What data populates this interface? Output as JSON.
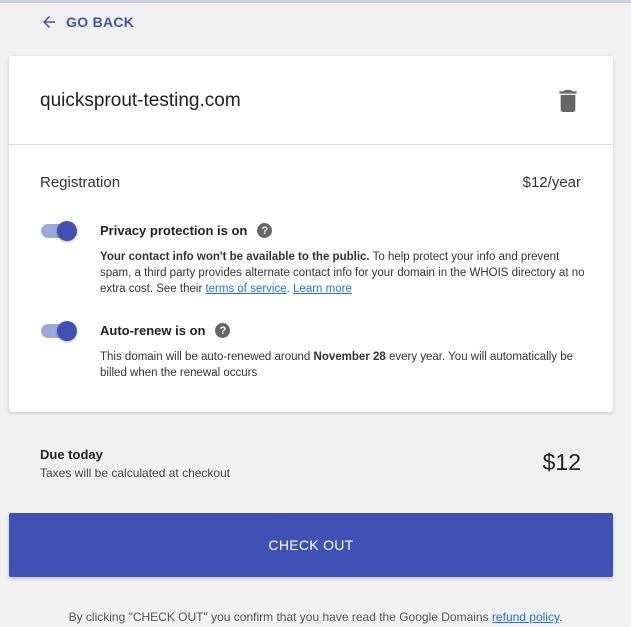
{
  "nav": {
    "back_label": "GO BACK"
  },
  "domain_card": {
    "domain_name": "quicksprout-testing.com",
    "registration_label": "Registration",
    "registration_price": "$12/year",
    "privacy": {
      "enabled": true,
      "title": "Privacy protection is on",
      "desc_bold": "Your contact info won't be available to the public.",
      "desc_text": " To help protect your info and prevent spam, a third party provides alternate contact info for your domain in the WHOIS directory at no extra cost. See their ",
      "tos_link": "terms of service",
      "sep": ". ",
      "learn_more_link": "Learn more"
    },
    "autorenew": {
      "enabled": true,
      "title": "Auto-renew is on",
      "desc_pre": "This domain will be auto-renewed around ",
      "desc_date": "November 28",
      "desc_post": " every year. You will automatically be billed when the renewal occurs"
    }
  },
  "summary": {
    "due_title": "Due today",
    "tax_note": "Taxes will be calculated at checkout",
    "due_amount": "$12"
  },
  "checkout_label": "CHECK OUT",
  "footer": {
    "text": "By clicking \"CHECK OUT\" you confirm that you have read the Google Domains ",
    "link": "refund policy",
    "end": "."
  },
  "colors": {
    "accent": "#3f51b5",
    "toggle_track": "#9fa8da",
    "link": "#1a73e8"
  },
  "icons": {
    "back": "arrow-left-icon",
    "delete": "trash-icon",
    "help": "help-circle-icon"
  }
}
